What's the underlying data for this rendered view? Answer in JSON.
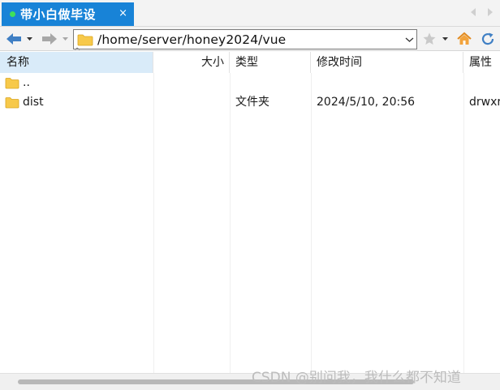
{
  "tab": {
    "title": "带小白做毕设",
    "close_label": "×"
  },
  "toolbar": {
    "address": "/home/server/honey2024/vue"
  },
  "columns": {
    "name": "名称",
    "size": "大小",
    "type": "类型",
    "mtime": "修改时间",
    "attr": "属性"
  },
  "rows": [
    {
      "name": "..",
      "size": "",
      "type": "",
      "mtime": "",
      "attr": ""
    },
    {
      "name": "dist",
      "size": "",
      "type": "文件夹",
      "mtime": "2024/5/10, 20:56",
      "attr": "drwxr"
    }
  ],
  "watermark": "CSDN @别问我，我什么都不知道",
  "colors": {
    "accent": "#1883d7",
    "header_selected": "#d9ebf9",
    "folder": "#f7c94a"
  }
}
